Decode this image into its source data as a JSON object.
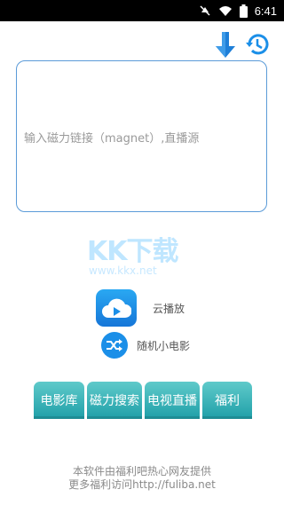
{
  "status_bar": {
    "time": "6:41",
    "icons": [
      "mute-icon",
      "wifi-icon",
      "battery-icon"
    ]
  },
  "toolbar": {
    "download_icon": "download-arrow-icon",
    "history_icon": "history-clock-icon"
  },
  "magnet_input": {
    "value": "",
    "placeholder": "输入磁力链接（magnet）,直播源"
  },
  "watermark": {
    "logo_text": "KK下载",
    "url_text": "www.kkx.net"
  },
  "menu": {
    "cloud_play": {
      "label": "云播放",
      "icon": "cloud-play-icon"
    },
    "random_movie": {
      "label": "随机小电影",
      "icon": "shuffle-icon"
    }
  },
  "nav_tabs": [
    {
      "label": "电影库"
    },
    {
      "label": "磁力搜索"
    },
    {
      "label": "电视直播"
    },
    {
      "label": "福利"
    }
  ],
  "footer": {
    "line1": "本软件由福利吧热心网友提供",
    "line2": "更多福利访问http://fuliba.net"
  },
  "colors": {
    "accent": "#1b8fe8",
    "input_border": "#5b9bd8",
    "tab_top": "#5fcaca",
    "tab_bottom": "#1f9fa8",
    "status_bar": "#000000"
  }
}
